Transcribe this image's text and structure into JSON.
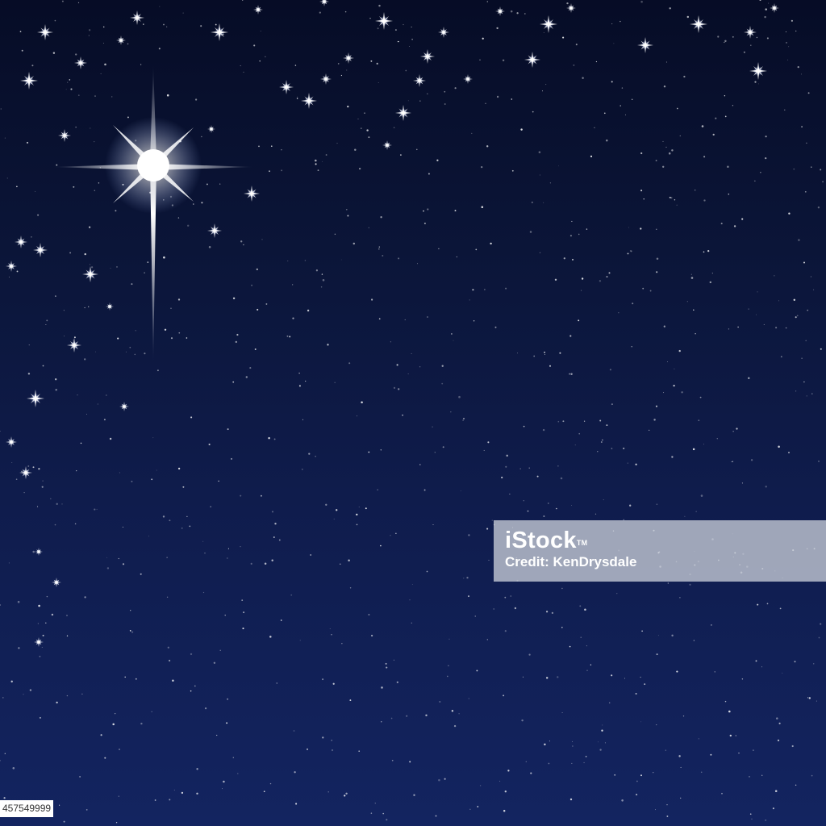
{
  "scene": {
    "description_colors": {
      "sky_top": "#060c26",
      "sky_bottom": "#132460",
      "star_color": "#ffffff"
    },
    "main_star": "bright-cross-star-icon"
  },
  "watermark": {
    "brand": "iStock",
    "trademark": "TM",
    "credit": "Credit: KenDrysdale"
  },
  "image_id": "457549999"
}
